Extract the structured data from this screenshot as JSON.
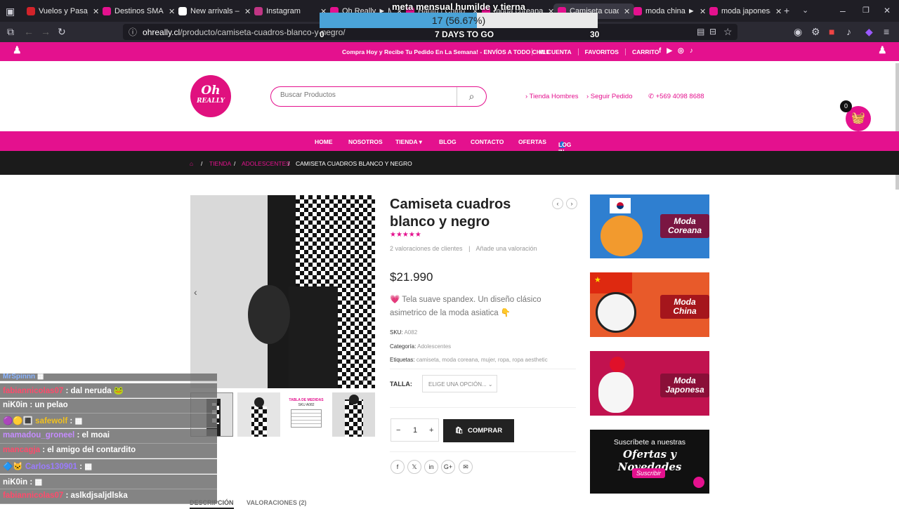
{
  "browser": {
    "tabs": [
      {
        "label": "Vuelos y Pasajes en",
        "color": "#d2232a"
      },
      {
        "label": "Destinos SMART: E",
        "color": "#e4118e"
      },
      {
        "label": "New arrivals – Rese",
        "color": "#ffffff"
      },
      {
        "label": "Instagram",
        "color": "#c13584"
      },
      {
        "label": "Oh Really ► Moda",
        "color": "#e4118e"
      },
      {
        "label": "Hanfu | Chino homb",
        "color": "#e4118e"
      },
      {
        "label": "moda coreana ► O",
        "color": "#e4118e"
      },
      {
        "label": "Camiseta cuadros b",
        "color": "#e4118e"
      },
      {
        "label": "moda china ► Oh R",
        "color": "#e4118e"
      },
      {
        "label": "moda japonesa ► O",
        "color": "#e4118e"
      }
    ],
    "url_host": "ohreally.cl",
    "url_path": "/producto/camiseta-cuadros-blanco-y-negro/"
  },
  "goal": {
    "title": "meta mensual humilde y tierna",
    "percent_text": "17 (56.67%)",
    "progress": 0.5667,
    "low": "0",
    "high": "30",
    "days": "7 DAYS TO GO"
  },
  "topbar": {
    "promo": "Compra Hoy y Recibe Tu Pedido En La Semana! - ENVÍOS A TODO CHILE",
    "links": [
      "MI CUENTA",
      "FAVORITOS",
      "CARRITO"
    ]
  },
  "header": {
    "logo_main": "Oh",
    "logo_sub": "REALLY",
    "search_placeholder": "Buscar Productos",
    "link_hombres": "› Tienda Hombres",
    "link_pedido": "› Seguir Pedido",
    "phone": "+569 4098 8688",
    "cart_count": "0"
  },
  "nav": {
    "items": [
      "HOME",
      "NOSOTROS",
      "TIENDA ▾",
      "BLOG",
      "CONTACTO",
      "OFERTAS",
      "LOG IN"
    ]
  },
  "breadcrumb": {
    "items": [
      "TIENDA",
      "ADOLESCENTES",
      "CAMISETA CUADROS BLANCO Y NEGRO"
    ]
  },
  "product": {
    "title": "Camiseta cuadros blanco y negro",
    "stars": "★★★★★",
    "reviews": "2 valoraciones de clientes",
    "add_review": "Añade una valoración",
    "price": "$21.990",
    "description": "💗 Tela suave spandex. Un diseño clásico asimetrico de la moda asiatica 👇",
    "sku_label": "SKU:",
    "sku": "A082",
    "category_label": "Categoría:",
    "category": "Adolescentes",
    "tags_label": "Etiquetas:",
    "tags": "camiseta, moda coreana, mujer, ropa, ropa aesthetic",
    "size_label": "TALLA:",
    "size_select": "ELIGE UNA OPCIÓN...",
    "qty": "1",
    "buy": "COMPRAR",
    "thumb_table_title": "TABLA DE MEDIDAS",
    "thumb_table_sku": "SKU A082"
  },
  "banners": [
    {
      "label": "Moda Coreana"
    },
    {
      "label": "Moda China"
    },
    {
      "label": "Moda Japonesa"
    },
    {
      "title": "Suscríbete a nuestras",
      "big": "Ofertas y Novedades",
      "button": "Suscribir"
    }
  ],
  "tabs": [
    "DESCRIPCIÓN",
    "VALORACIONES (2)"
  ],
  "chat": [
    {
      "user": "MrSpinnn",
      "msg": "",
      "color": "#8ab4ff"
    },
    {
      "user": "fabiannicolas07",
      "msg": ": dal neruda",
      "color": "#ff4a6b"
    },
    {
      "user": "niK0in",
      "msg": ": un pelao",
      "color": "#ffffff"
    },
    {
      "user": "safewolf",
      "msg": ":",
      "color": "#f0c020"
    },
    {
      "user": "mamadou_groneel",
      "msg": ": el moai",
      "color": "#c58cff"
    },
    {
      "user": "mancagja",
      "msg": ": el amigo del contardito",
      "color": "#ff4a6b"
    },
    {
      "user": "Carlos130901",
      "msg": ":",
      "color": "#9b7bff"
    },
    {
      "user": "niK0in",
      "msg": ":",
      "color": "#ffffff"
    },
    {
      "user": "fabiannicolas07",
      "msg": ": aslkdjsaljdlska",
      "color": "#ff4a6b"
    }
  ]
}
